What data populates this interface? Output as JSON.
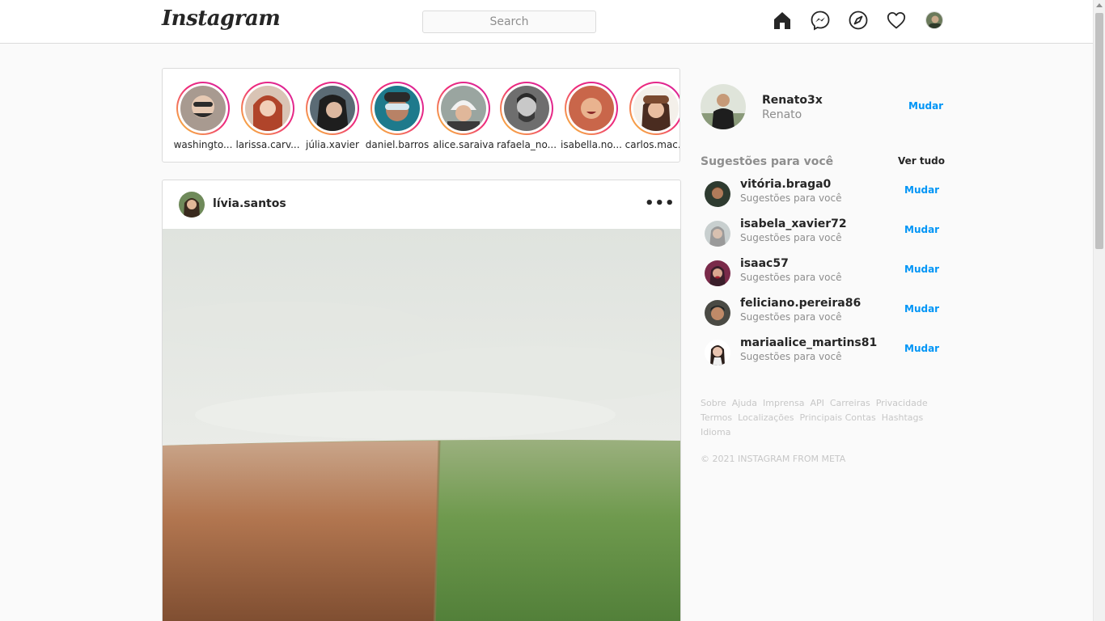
{
  "header": {
    "logo": "Instagram",
    "search_placeholder": "Search",
    "icons": [
      "home-icon",
      "messenger-icon",
      "explore-icon",
      "heart-icon",
      "profile-avatar"
    ]
  },
  "stories": [
    {
      "name": "washingto..."
    },
    {
      "name": "larissa.carv..."
    },
    {
      "name": "júlia.xavier"
    },
    {
      "name": "daniel.barros"
    },
    {
      "name": "alice.saraiva"
    },
    {
      "name": "rafaela_no..."
    },
    {
      "name": "isabella.no..."
    },
    {
      "name": "carlos.mac..."
    }
  ],
  "post": {
    "username": "lívia.santos",
    "more": "•••"
  },
  "profile": {
    "username": "Renato3x",
    "name": "Renato",
    "switch_label": "Mudar"
  },
  "suggestions": {
    "title": "Sugestões para você",
    "see_all": "Ver tudo",
    "items": [
      {
        "username": "vitória.braga0",
        "subtitle": "Sugestões para você",
        "action": "Mudar"
      },
      {
        "username": "isabela_xavier72",
        "subtitle": "Sugestões para você",
        "action": "Mudar"
      },
      {
        "username": "isaac57",
        "subtitle": "Sugestões para você",
        "action": "Mudar"
      },
      {
        "username": "feliciano.pereira86",
        "subtitle": "Sugestões para você",
        "action": "Mudar"
      },
      {
        "username": "mariaalice_martins81",
        "subtitle": "Sugestões para você",
        "action": "Mudar"
      }
    ]
  },
  "footer": {
    "links": [
      "Sobre",
      "Ajuda",
      "Imprensa",
      "API",
      "Carreiras",
      "Privacidade",
      "Termos",
      "Localizações",
      "Principais Contas",
      "Hashtags",
      "Idioma"
    ],
    "copyright": "© 2021 INSTAGRAM FROM META"
  },
  "colors": {
    "accent": "#0095f6",
    "border": "#dbdbdb",
    "background": "#fafafa",
    "muted_text": "#8e8e8e"
  }
}
